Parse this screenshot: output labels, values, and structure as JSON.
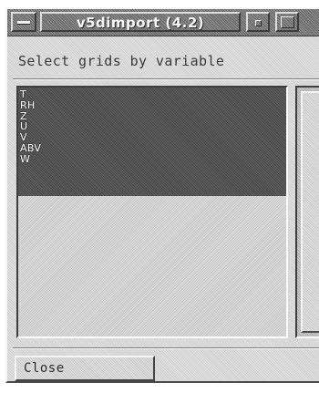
{
  "window": {
    "title": "v5dimport (4.2)"
  },
  "instruction": "Select grids by variable",
  "variables": {
    "items": [
      "T",
      "RH",
      "Z",
      "U",
      "V",
      "ABV",
      "W"
    ]
  },
  "buttons": {
    "close_label": "Close"
  },
  "icons": {
    "window_menu": "window-menu-icon",
    "minimize": "minimize-icon",
    "maximize": "maximize-icon"
  },
  "colors": {
    "titlebar": "#777777",
    "window_bg": "#d9d9d9",
    "selection": "#565656",
    "title_text": "#f7f7f7"
  }
}
